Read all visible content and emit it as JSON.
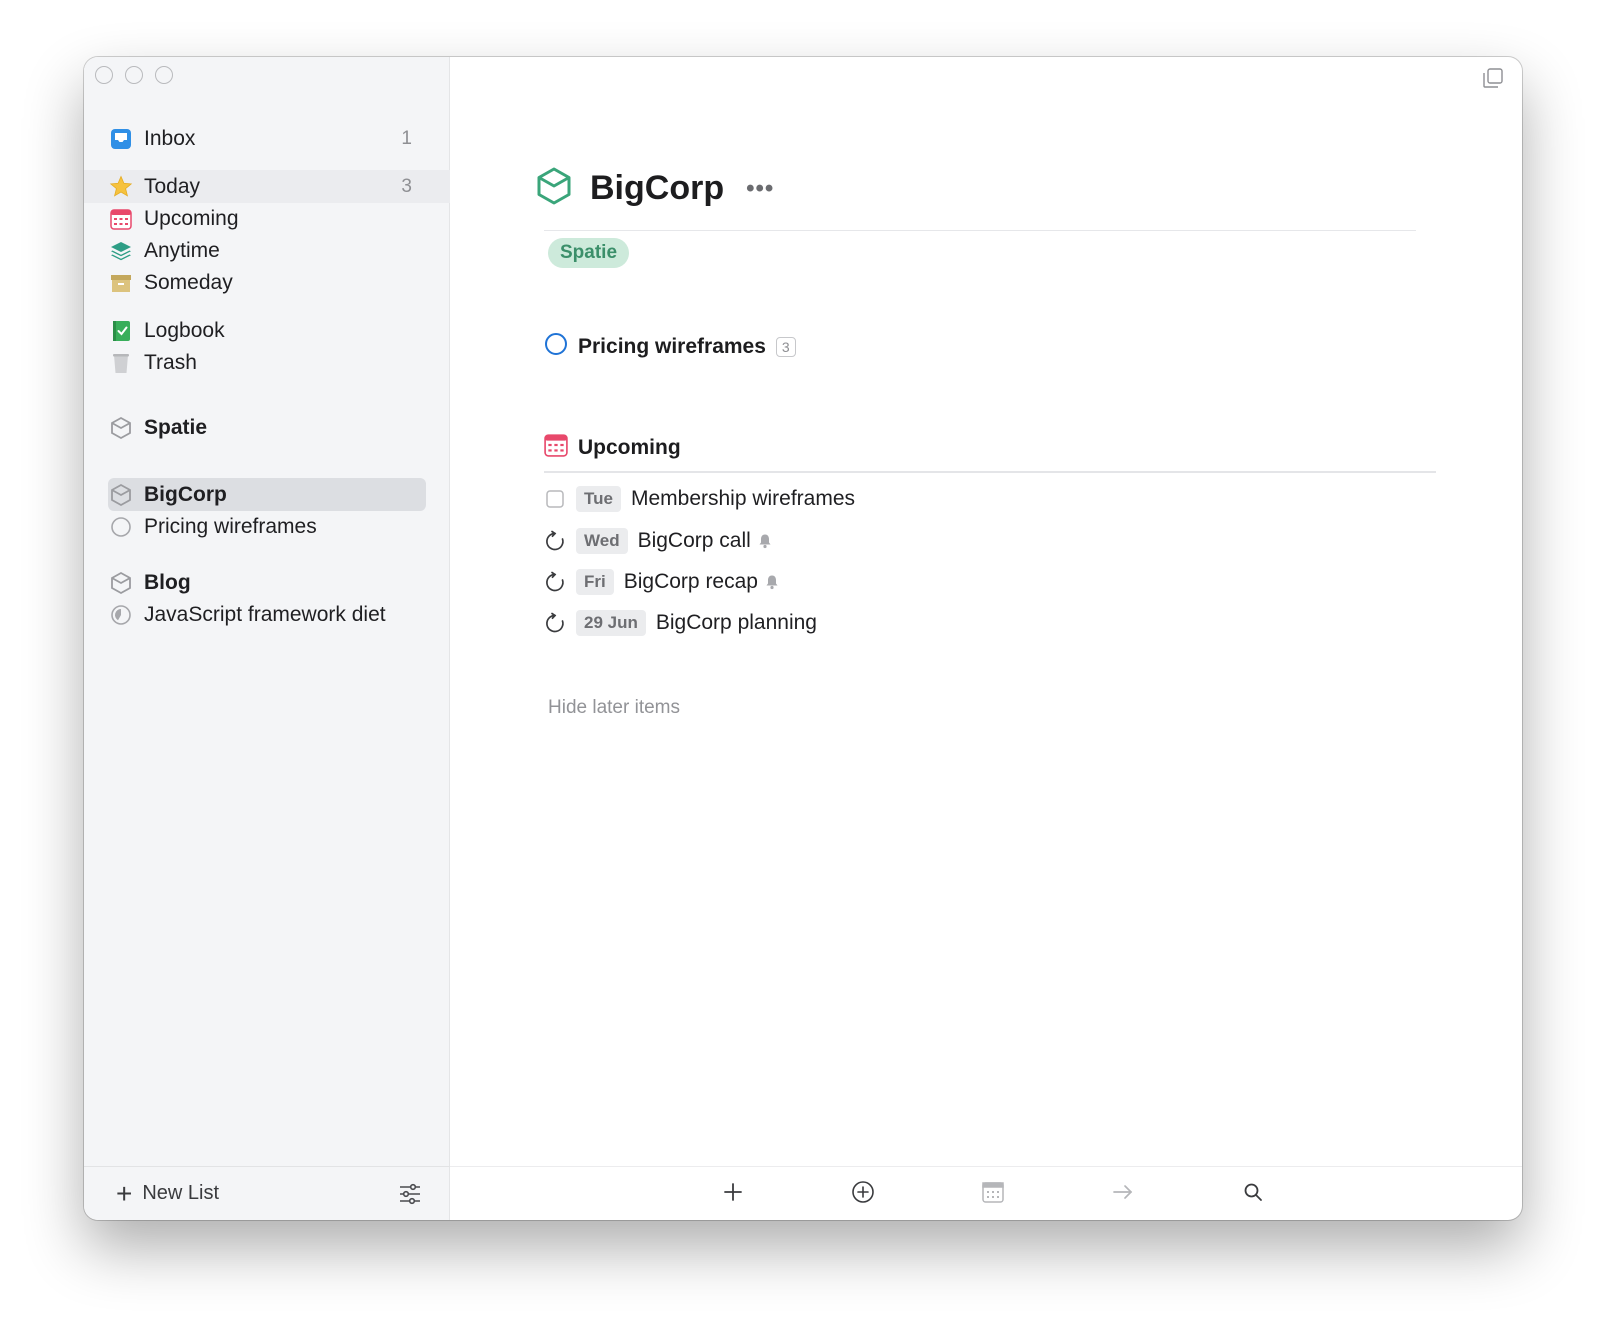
{
  "sidebar": {
    "inbox": {
      "label": "Inbox",
      "count": "1"
    },
    "today": {
      "label": "Today",
      "count": "3"
    },
    "upcoming": {
      "label": "Upcoming"
    },
    "anytime": {
      "label": "Anytime"
    },
    "someday": {
      "label": "Someday"
    },
    "logbook": {
      "label": "Logbook"
    },
    "trash": {
      "label": "Trash"
    },
    "areas": [
      {
        "label": "Spatie"
      },
      {
        "label": "BigCorp",
        "projects": [
          {
            "label": "Pricing wireframes"
          }
        ]
      },
      {
        "label": "Blog",
        "projects": [
          {
            "label": "JavaScript framework diet"
          }
        ]
      }
    ],
    "footer": {
      "new_list_label": "New List"
    }
  },
  "main": {
    "title": "BigCorp",
    "more_label": "•••",
    "tag": "Spatie",
    "project": {
      "label": "Pricing wireframes",
      "count": "3"
    },
    "section": {
      "label": "Upcoming"
    },
    "tasks": [
      {
        "date": "Tue",
        "text": "Membership wireframes",
        "kind": "checkbox",
        "reminder": false
      },
      {
        "date": "Wed",
        "text": "BigCorp call",
        "kind": "repeat",
        "reminder": true
      },
      {
        "date": "Fri",
        "text": "BigCorp recap",
        "kind": "repeat",
        "reminder": true
      },
      {
        "date": "29 Jun",
        "text": "BigCorp planning",
        "kind": "repeat",
        "reminder": false
      }
    ],
    "hide_later_label": "Hide later items"
  },
  "icons": {
    "inbox": "inbox-icon",
    "today": "star-icon",
    "upcoming": "calendar-icon",
    "anytime": "layers-icon",
    "someday": "box-icon",
    "logbook": "logbook-icon",
    "trash": "trash-icon",
    "area": "cube-icon",
    "project": "circle-icon"
  },
  "colors": {
    "accent_blue": "#1f73d6",
    "area_green": "#3aa57a",
    "tag_bg": "#cdeadb",
    "upcoming_red": "#e8486b",
    "star_yellow": "#f6c23e"
  }
}
